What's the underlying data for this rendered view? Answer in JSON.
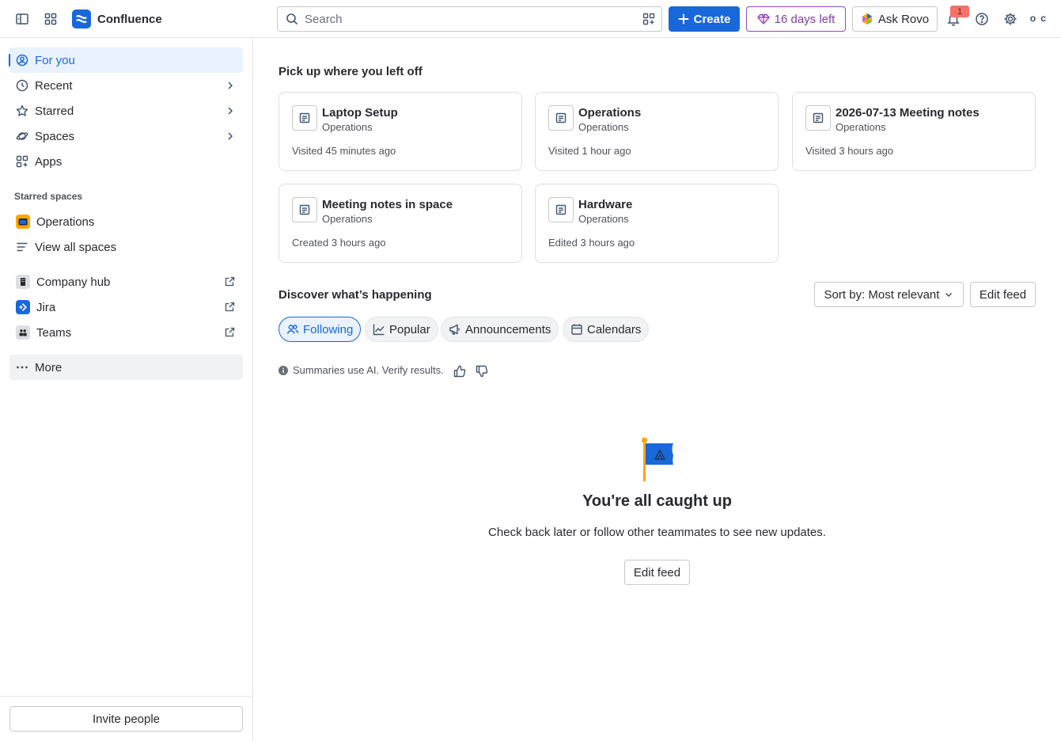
{
  "app": {
    "name": "Confluence"
  },
  "topbar": {
    "search_placeholder": "Search",
    "create_label": "Create",
    "trial_label": "16 days left",
    "rovo_label": "Ask Rovo",
    "notification_count": "1",
    "avatar_initials": "O C",
    "colors": {
      "brand": "#1868db",
      "trial": "#964ac0"
    }
  },
  "sidebar": {
    "nav": [
      {
        "label": "For you",
        "icon": "user-circle-icon",
        "active": true
      },
      {
        "label": "Recent",
        "icon": "clock-icon"
      },
      {
        "label": "Starred",
        "icon": "star-icon"
      },
      {
        "label": "Spaces",
        "icon": "planet-icon"
      },
      {
        "label": "Apps",
        "icon": "apps-icon"
      }
    ],
    "starred_spaces_label": "Starred spaces",
    "starred_spaces": [
      {
        "label": "Operations"
      }
    ],
    "view_all_spaces": "View all spaces",
    "external": [
      {
        "label": "Company hub"
      },
      {
        "label": "Jira"
      },
      {
        "label": "Teams"
      }
    ],
    "more_label": "More",
    "invite_label": "Invite people"
  },
  "main": {
    "recent_heading": "Pick up where you left off",
    "recent_cards": [
      {
        "title": "Laptop Setup",
        "space": "Operations",
        "meta": "Visited 45 minutes ago"
      },
      {
        "title": "Operations",
        "space": "Operations",
        "meta": "Visited 1 hour ago"
      },
      {
        "title": "2026-07-13 Meeting notes",
        "space": "Operations",
        "meta": "Visited 3 hours ago"
      },
      {
        "title": "Meeting notes in space",
        "space": "Operations",
        "meta": "Created 3 hours ago"
      },
      {
        "title": "Hardware",
        "space": "Operations",
        "meta": "Edited 3 hours ago"
      }
    ],
    "discover_heading": "Discover what’s happening",
    "sort_label": "Sort by: Most relevant",
    "edit_feed_label": "Edit feed",
    "tabs": [
      {
        "label": "Following",
        "active": true
      },
      {
        "label": "Popular"
      },
      {
        "label": "Announcements"
      },
      {
        "label": "Calendars"
      }
    ],
    "ai_note": "Summaries use AI. Verify results.",
    "empty_title": "You're all caught up",
    "empty_subtitle": "Check back later or follow other teammates to see new updates.",
    "empty_button": "Edit feed"
  }
}
